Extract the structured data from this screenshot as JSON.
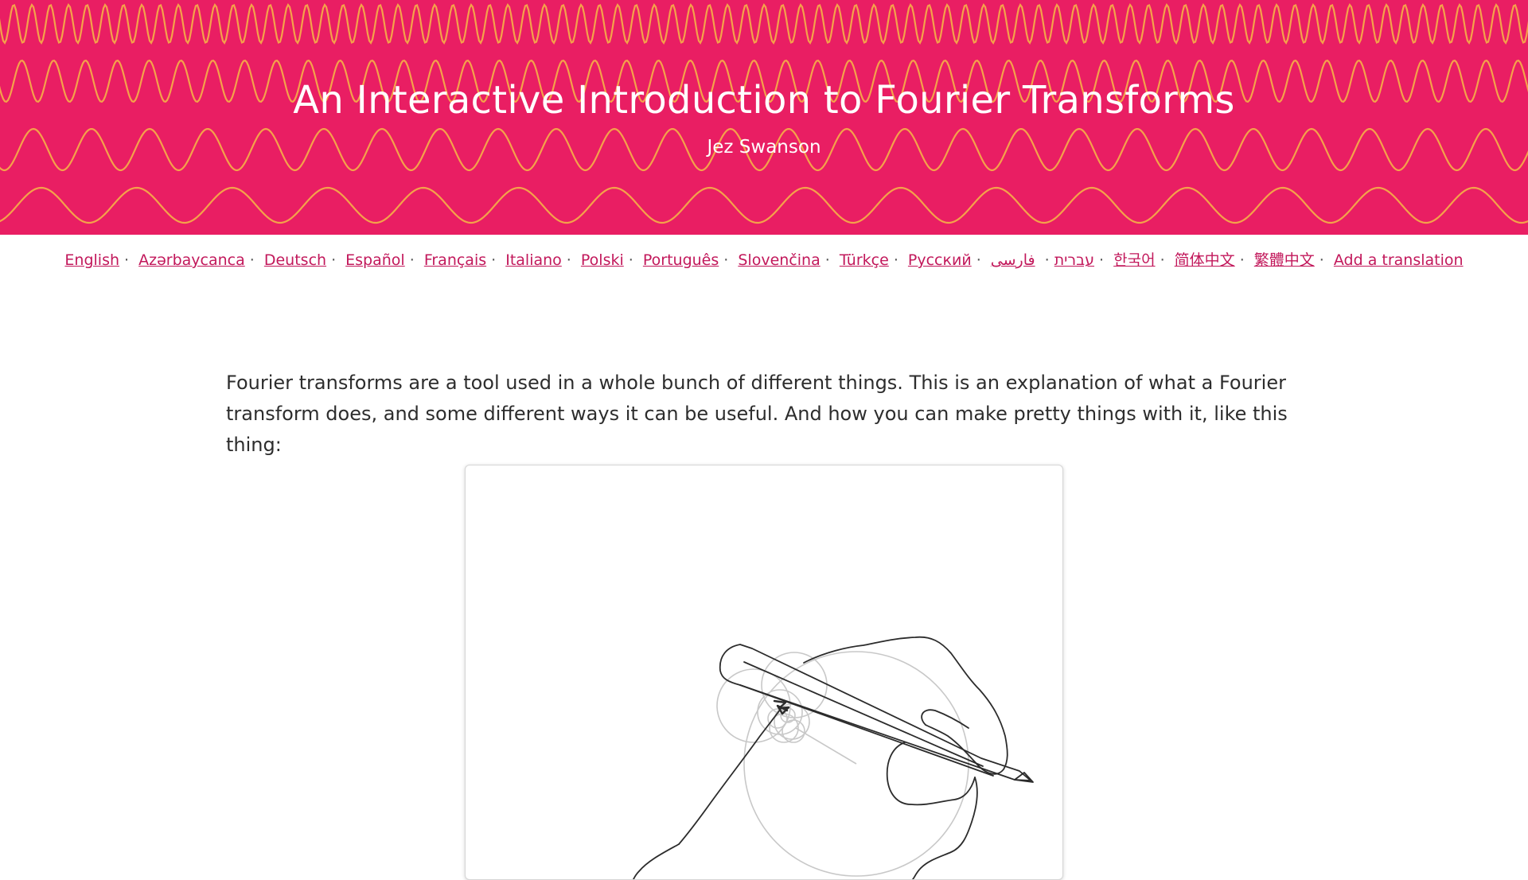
{
  "header": {
    "title": "An Interactive Introduction to Fourier Transforms",
    "author": "Jez Swanson",
    "colors": {
      "background": "#e91e63",
      "wave": "#f4a24a",
      "text": "#ffffff"
    }
  },
  "languages": {
    "items": [
      "English",
      "Azərbaycanca",
      "Deutsch",
      "Español",
      "Français",
      "Italiano",
      "Polski",
      "Português",
      "Slovenčina",
      "Türkçe",
      "Русский",
      "עברית",
      "فارسی",
      "한국어",
      "简体中文",
      "繁體中文"
    ],
    "add_translation": "Add a translation",
    "separator": "·",
    "link_color": "#c2185b"
  },
  "intro": {
    "text": "Fourier transforms are a tool used in a whole bunch of different things. This is an explanation of what a Fourier transform does, and some different ways it can be useful. And how you can make pretty things with it, like this thing:"
  }
}
